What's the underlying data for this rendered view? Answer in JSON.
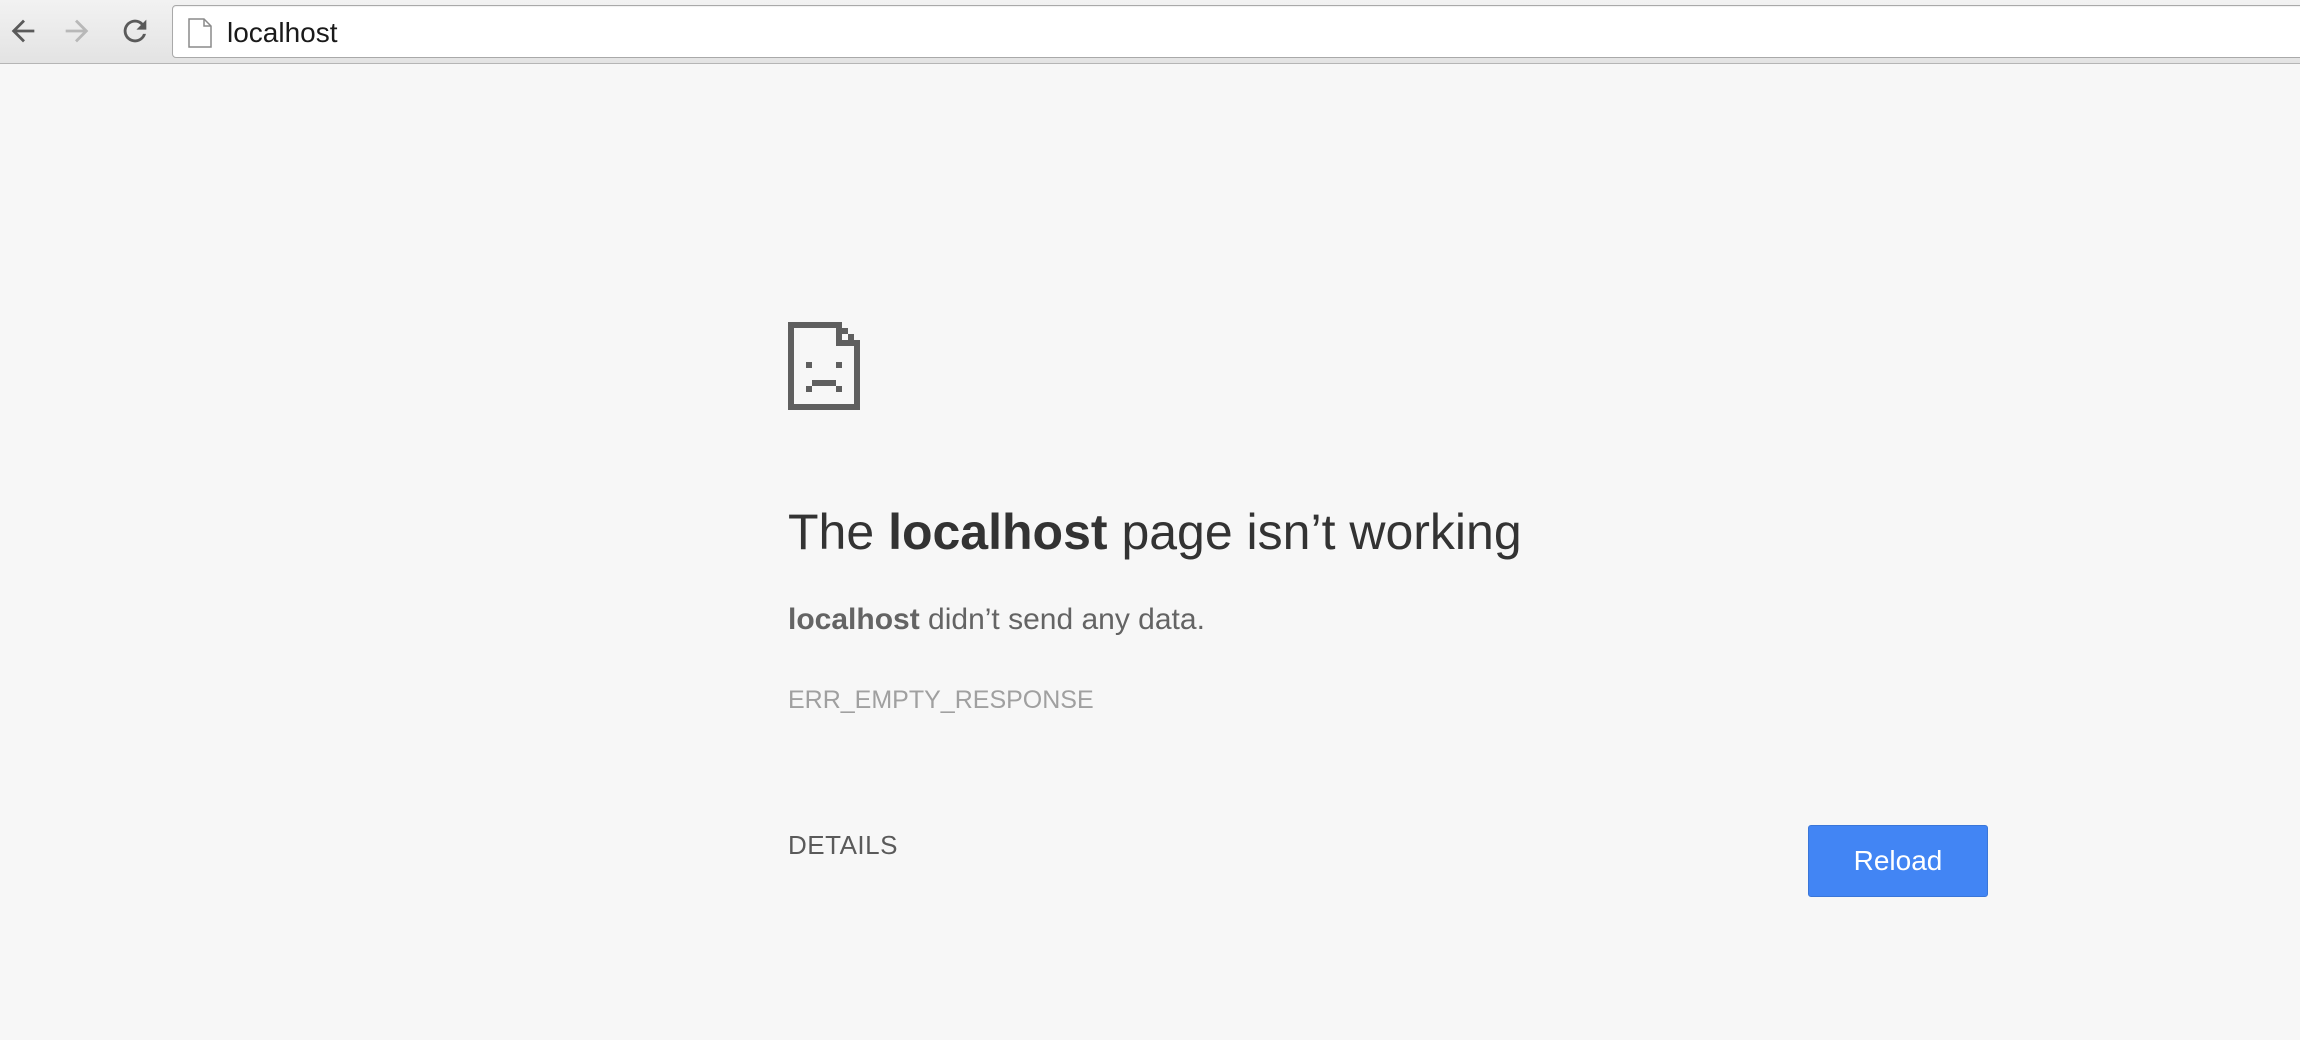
{
  "browser": {
    "back_icon": "arrow-left-icon",
    "forward_icon": "arrow-right-icon",
    "reload_icon": "reload-icon",
    "page_icon": "blank-page-icon",
    "url": "localhost",
    "colors": {
      "toolbar_bg": "#e8e8e8",
      "back_enabled": "#5a5a5a",
      "forward_disabled": "#b8b8b8"
    }
  },
  "error": {
    "icon": "sad-page-icon",
    "headline_prefix": "The ",
    "headline_host": "localhost",
    "headline_suffix": " page isn’t working",
    "summary_host": "localhost",
    "summary_text": " didn’t send any data.",
    "code": "ERR_EMPTY_RESPONSE",
    "details_label": "DETAILS",
    "reload_label": "Reload",
    "colors": {
      "page_bg": "#f7f7f7",
      "headline": "#333333",
      "summary": "#646464",
      "code": "#a0a0a0",
      "reload_button": "#4285f4"
    }
  }
}
